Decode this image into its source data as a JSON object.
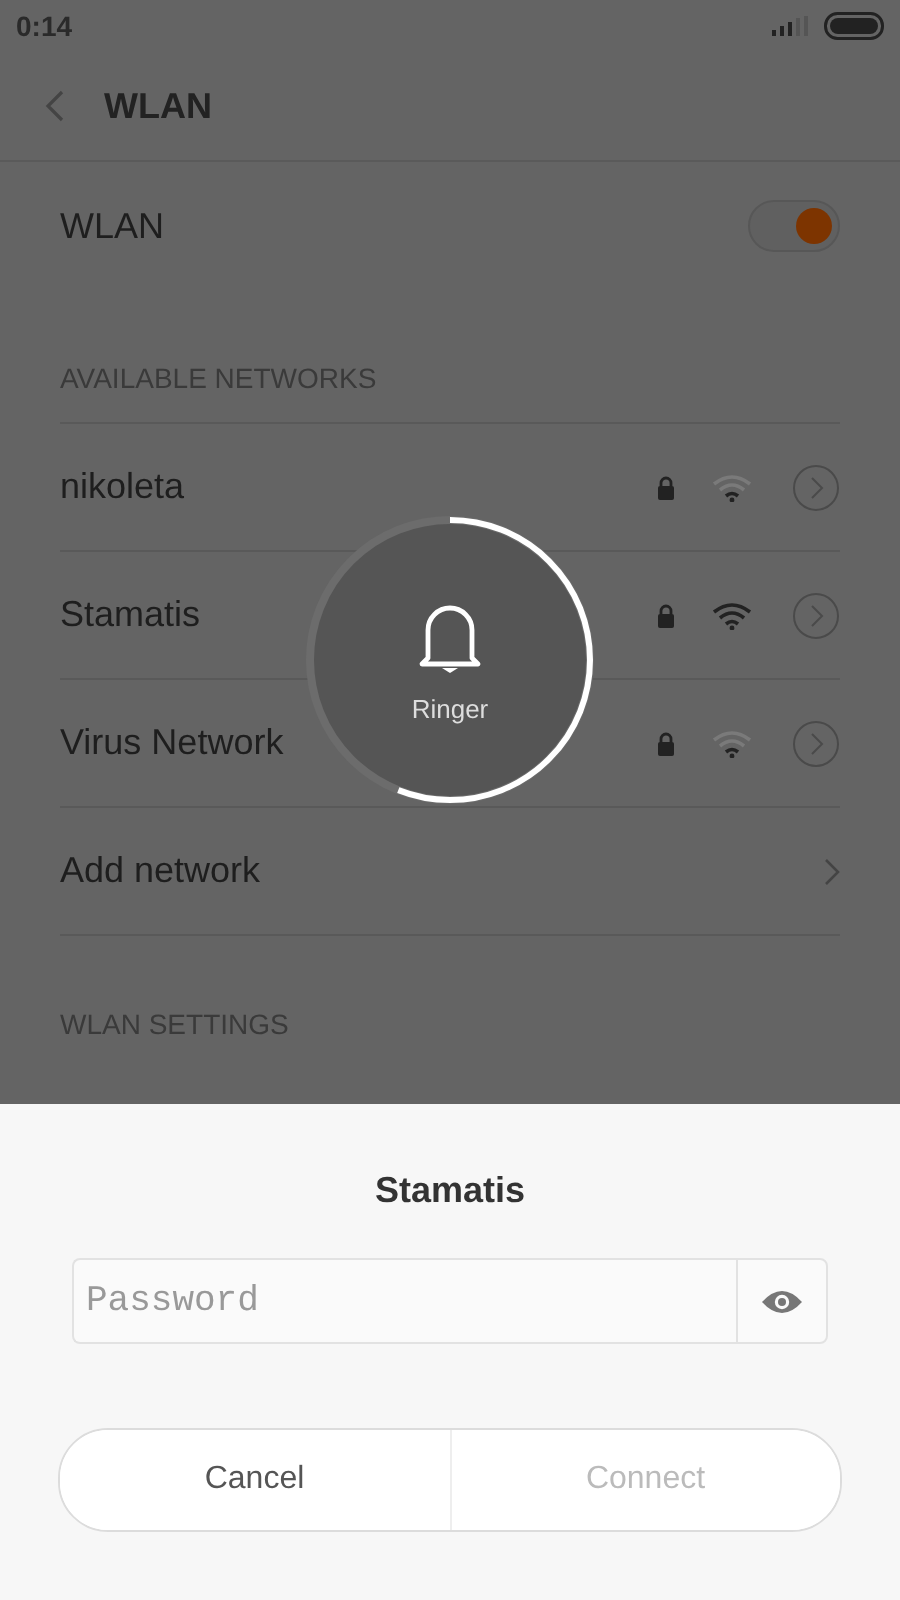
{
  "status_bar": {
    "time": "0:14"
  },
  "header": {
    "title": "WLAN"
  },
  "wlan_toggle": {
    "label": "WLAN",
    "on": true
  },
  "available_section": {
    "title": "AVAILABLE NETWORKS",
    "networks": [
      {
        "name": "nikoleta",
        "secured": true,
        "strong": false
      },
      {
        "name": "Stamatis",
        "secured": true,
        "strong": true
      },
      {
        "name": "Virus Network",
        "secured": true,
        "strong": false
      }
    ],
    "add_network": "Add network"
  },
  "settings_section": {
    "title": "WLAN SETTINGS"
  },
  "ringer": {
    "label": "Ringer"
  },
  "dialog": {
    "title": "Stamatis",
    "password": {
      "placeholder": "Password"
    },
    "buttons": [
      {
        "label": "Cancel",
        "disabled": false
      },
      {
        "label": "Connect",
        "disabled": true
      }
    ]
  }
}
